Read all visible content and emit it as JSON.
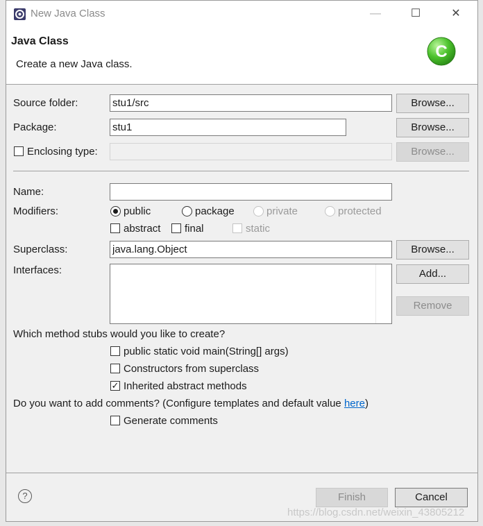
{
  "window": {
    "title": "New Java Class",
    "minimize_glyph": "—",
    "maximize_glyph": "☐",
    "close_glyph": "✕"
  },
  "header": {
    "title": "Java Class",
    "description": "Create a new Java class.",
    "wizard_icon": "java-class-c-icon",
    "wizard_letter": "C",
    "accent_color": "#4cc22c"
  },
  "form": {
    "source_folder": {
      "label": "Source folder:",
      "value": "stu1/src",
      "browse": "Browse..."
    },
    "package": {
      "label": "Package:",
      "value": "stu1",
      "browse": "Browse..."
    },
    "enclosing_type": {
      "label": "Enclosing type:",
      "value": "",
      "browse": "Browse...",
      "checked": false
    },
    "name": {
      "label": "Name:",
      "value": ""
    },
    "modifiers": {
      "label": "Modifiers:",
      "access": [
        {
          "label": "public",
          "checked": true,
          "enabled": true
        },
        {
          "label": "package",
          "checked": false,
          "enabled": true
        },
        {
          "label": "private",
          "checked": false,
          "enabled": false
        },
        {
          "label": "protected",
          "checked": false,
          "enabled": false
        }
      ],
      "flags": [
        {
          "label": "abstract",
          "checked": false,
          "enabled": true
        },
        {
          "label": "final",
          "checked": false,
          "enabled": true
        },
        {
          "label": "static",
          "checked": false,
          "enabled": false
        }
      ]
    },
    "superclass": {
      "label": "Superclass:",
      "value": "java.lang.Object",
      "browse": "Browse..."
    },
    "interfaces": {
      "label": "Interfaces:",
      "add": "Add...",
      "remove": "Remove"
    },
    "stubs": {
      "question": "Which method stubs would you like to create?",
      "options": [
        {
          "label": "public static void main(String[] args)",
          "checked": false
        },
        {
          "label": "Constructors from superclass",
          "checked": false
        },
        {
          "label": "Inherited abstract methods",
          "checked": true
        }
      ]
    },
    "comments": {
      "question": "Do you want to add comments? (Configure templates and default value ",
      "link": "here",
      "closing": ")",
      "option": {
        "label": "Generate comments",
        "checked": false
      }
    }
  },
  "footer": {
    "help_icon": "help-question-icon",
    "help_glyph": "?",
    "finish": "Finish",
    "cancel": "Cancel"
  },
  "check_glyph": "✓",
  "watermark": "https://blog.csdn.net/weixin_43805212"
}
